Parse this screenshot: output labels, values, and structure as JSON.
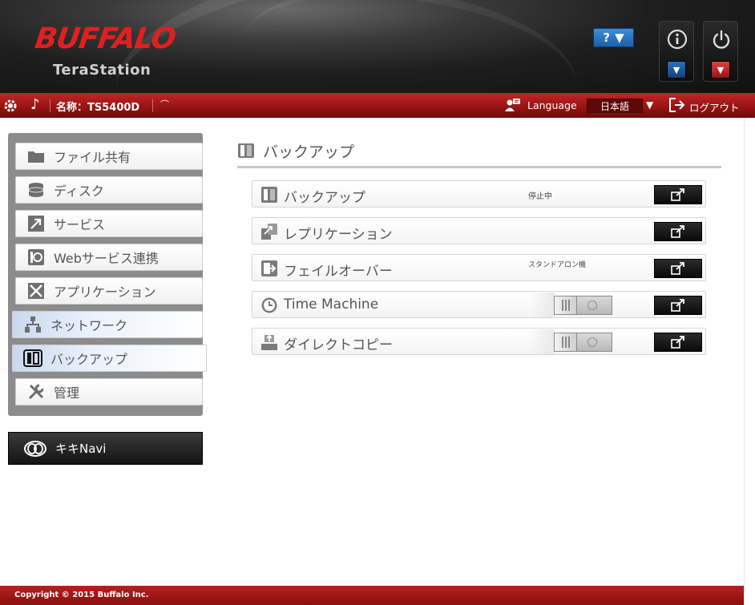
{
  "header": {
    "brand": "BUFFALO",
    "product": "TeraStation",
    "help_label": "?",
    "info_icon": "info-icon",
    "power_icon": "power-icon",
    "colors": {
      "brand_red": "#e02020",
      "bar_red": "#a81818",
      "help_blue": "#2a77c8"
    }
  },
  "topbar": {
    "device_name": "名称：TS5400D",
    "language_label": "Language",
    "language_value": "日本語",
    "logout_label": "ログアウト"
  },
  "sidebar": {
    "items": [
      {
        "label": "ファイル共有",
        "icon": "folder-icon"
      },
      {
        "label": "ディスク",
        "icon": "disk-icon"
      },
      {
        "label": "サービス",
        "icon": "service-icon"
      },
      {
        "label": "Webサービス連携",
        "icon": "web-service-icon"
      },
      {
        "label": "アプリケーション",
        "icon": "application-icon"
      },
      {
        "label": "ネットワーク",
        "icon": "network-icon"
      },
      {
        "label": "バックアップ",
        "icon": "backup-icon",
        "active": true
      },
      {
        "label": "管理",
        "icon": "tools-icon"
      }
    ],
    "kiki_navi": "キキNavi"
  },
  "main": {
    "title": "バックアップ",
    "rows": [
      {
        "label": "バックアップ",
        "status": "停止中",
        "icon": "backup-icon"
      },
      {
        "label": "レプリケーション",
        "status": "",
        "icon": "replication-icon"
      },
      {
        "label": "フェイルオーバー",
        "status": "スタンドアロン機",
        "icon": "failover-icon"
      },
      {
        "label": "Time Machine",
        "status": "",
        "icon": "time-machine-icon",
        "toggle": "off"
      },
      {
        "label": "ダイレクトコピー",
        "status": "",
        "icon": "direct-copy-icon",
        "toggle": "off"
      }
    ]
  },
  "footer": {
    "copyright": "Copyright © 2015 Buffalo Inc."
  }
}
